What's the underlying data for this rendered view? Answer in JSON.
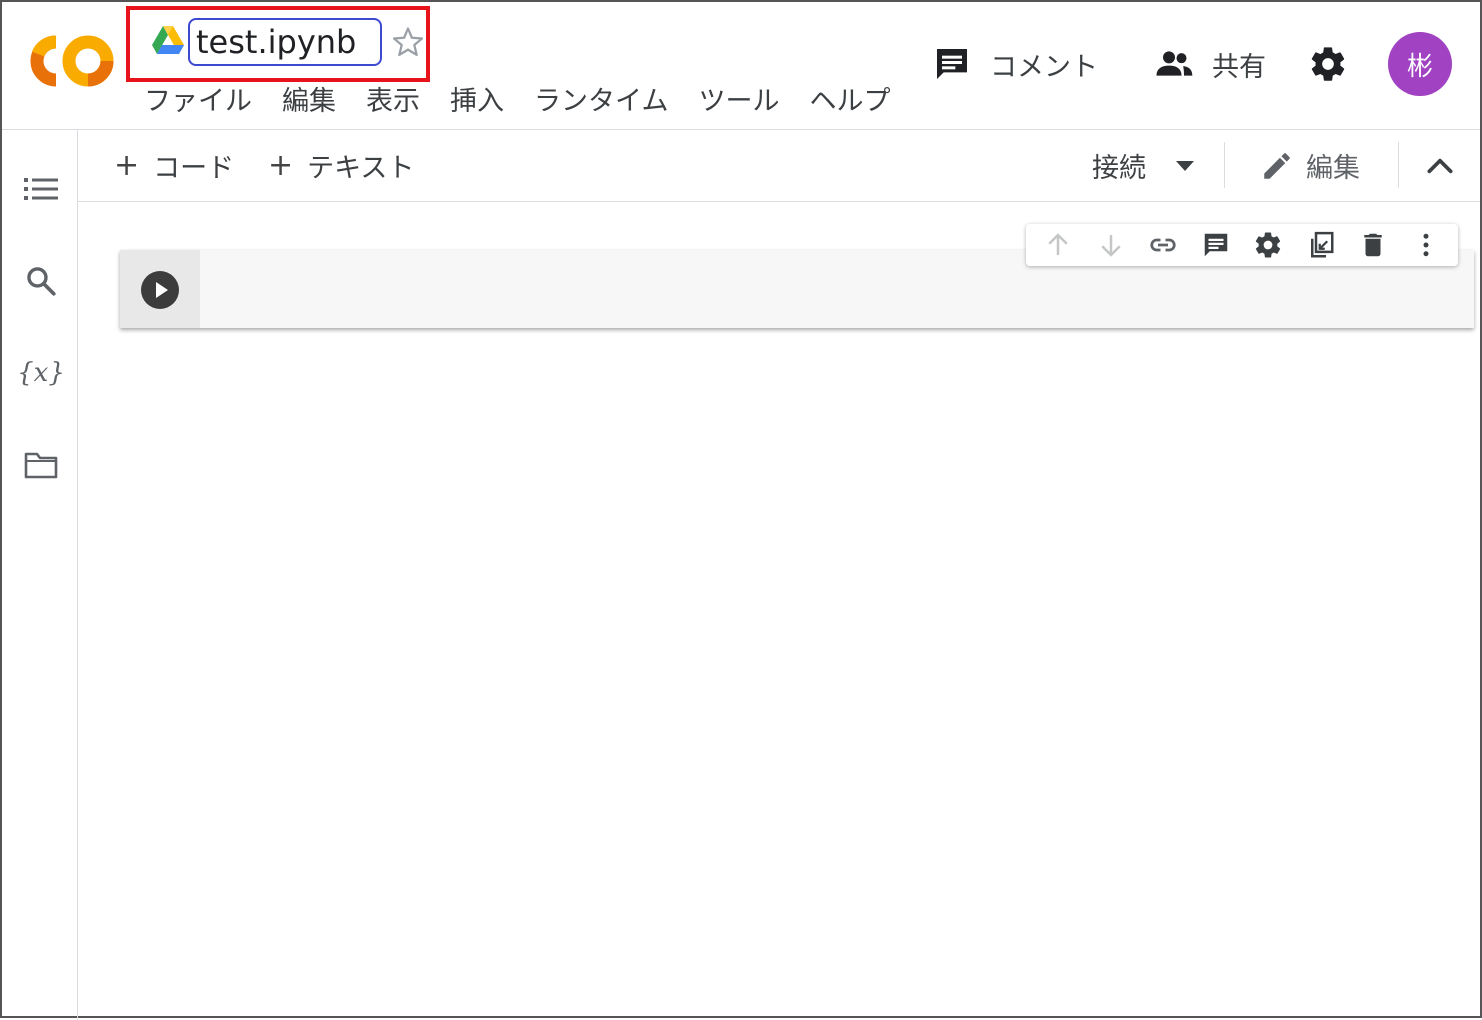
{
  "notebook": {
    "title": "test.ipynb"
  },
  "menu": {
    "items": [
      "ファイル",
      "編集",
      "表示",
      "挿入",
      "ランタイム",
      "ツール",
      "ヘルプ"
    ]
  },
  "header": {
    "comment_label": "コメント",
    "share_label": "共有",
    "avatar_initial": "彬",
    "avatar_color": "#a142c2"
  },
  "toolbar": {
    "add_code_label": "コード",
    "add_text_label": "テキスト",
    "connect_label": "接続",
    "edit_label": "編集"
  },
  "sidebar": {
    "vars_symbol": "{x}"
  },
  "colors": {
    "highlight_box": "#e8141c",
    "title_border": "#3c4ad1",
    "colab_orange": "#f9ab00",
    "colab_orange_dark": "#e8710a"
  }
}
